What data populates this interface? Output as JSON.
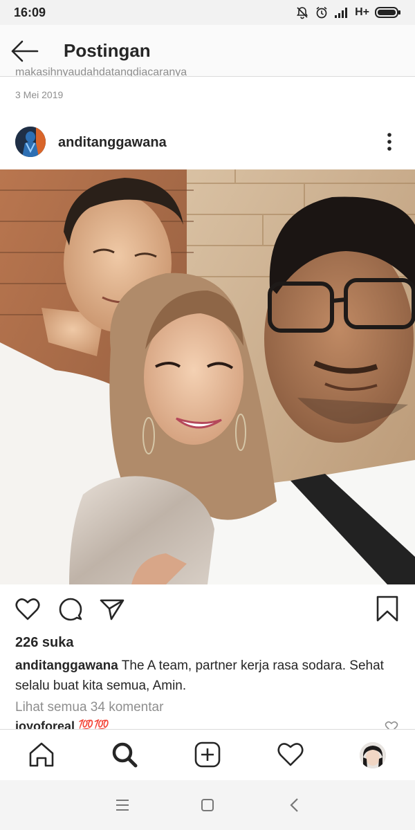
{
  "status_bar": {
    "time": "16:09",
    "network": "H+",
    "icons": [
      "mute-bell-icon",
      "alarm-icon",
      "signal-icon",
      "battery-icon"
    ]
  },
  "header": {
    "back_icon": "arrow-left-icon",
    "title": "Postingan"
  },
  "previous_post": {
    "caption_fragment": "makasihnyaudahdatangdiacaranya",
    "date": "3 Mei 2019"
  },
  "post": {
    "username": "anditanggawana",
    "more_icon": "vertical-dots-icon",
    "tag_icon": "person-tag-icon",
    "actions": {
      "like_icon": "heart-icon",
      "comment_icon": "comment-bubble-icon",
      "share_icon": "paper-plane-icon",
      "save_icon": "bookmark-icon"
    },
    "likes": "226 suka",
    "caption_user": "anditanggawana",
    "caption_text": "The A team, partner kerja rasa sodara. Sehat selalu buat kita semua, Amin.",
    "view_comments": "Lihat semua 34 komentar",
    "first_comment_user": "joyoforeal",
    "first_comment_text": "💯💯"
  },
  "bottom_nav": {
    "items": [
      "home-icon",
      "search-icon",
      "add-post-icon",
      "activity-heart-icon",
      "profile-avatar"
    ]
  },
  "android_nav": {
    "items": [
      "menu-icon",
      "home-square-icon",
      "back-chevron-icon"
    ]
  },
  "colors": {
    "text": "#262626",
    "muted": "#8e8e8e",
    "divider": "#dbdbdb"
  }
}
